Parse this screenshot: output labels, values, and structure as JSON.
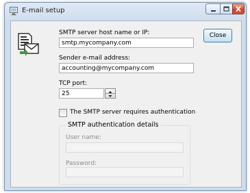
{
  "window": {
    "title": "E-mail setup",
    "close_label": "Close"
  },
  "smtp": {
    "host_label": "SMTP server host name or IP:",
    "host_value": "smtp.mycompany.com",
    "sender_label": "Sender e-mail address:",
    "sender_value": "accounting@mycompany.com",
    "port_label": "TCP port:",
    "port_value": "25",
    "auth_checkbox_label": "The SMTP server requires authentication",
    "auth_checked": false
  },
  "auth": {
    "group_title": "SMTP authentication details",
    "username_label": "User name:",
    "username_value": "",
    "password_label": "Password:",
    "password_value": ""
  },
  "icons": {
    "window_icon": "monitor-icon",
    "main_icon": "email-document-icon"
  }
}
